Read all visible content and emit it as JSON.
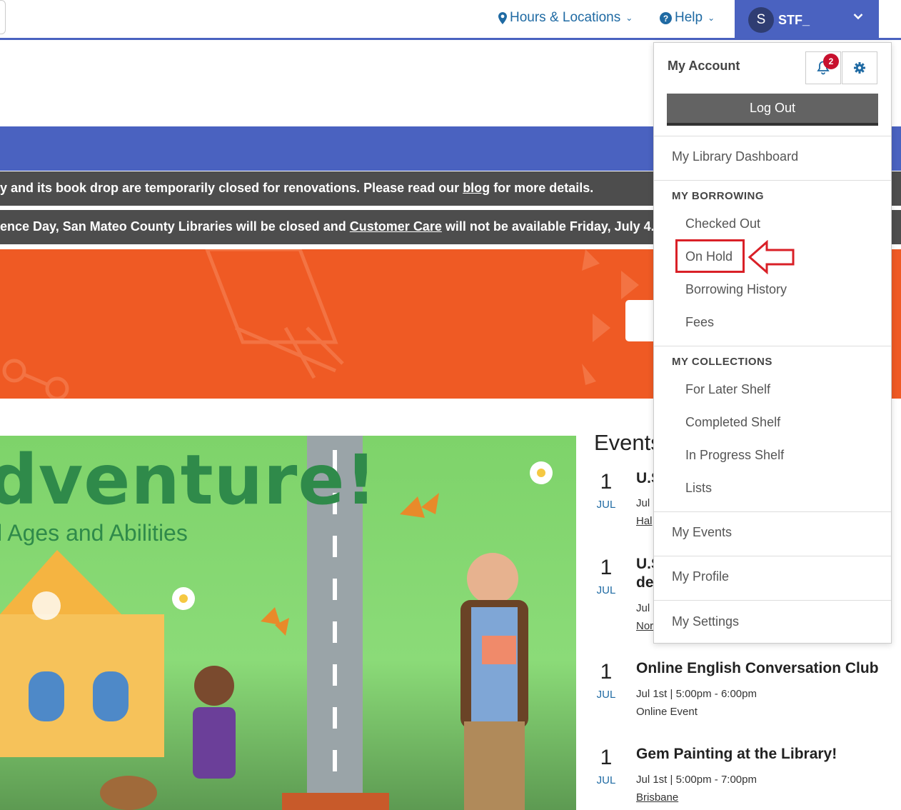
{
  "nav": {
    "hours_label": "Hours & Locations",
    "help_label": "Help",
    "account_initial": "S",
    "account_name": "STF_"
  },
  "alerts": {
    "alert1_pre": "y and its book drop are temporarily closed for renovations. Please read our ",
    "alert1_link": "blog",
    "alert1_post": " for more details.",
    "alert2_pre": "ence Day, San Mateo County Libraries will be closed and ",
    "alert2_link": "Customer Care",
    "alert2_post": " will not be available Friday, July 4."
  },
  "hero": {
    "title": "dventure!",
    "subtitle": "l Ages and Abilities"
  },
  "events": {
    "heading": "Events",
    "items": [
      {
        "day": "1",
        "month": "JUL",
        "title": "U.S",
        "title2": "",
        "time": "Jul 1",
        "location": "Hal"
      },
      {
        "day": "1",
        "month": "JUL",
        "title": "U.S",
        "title2": "de",
        "time": "Jul 1",
        "location": "Nor"
      },
      {
        "day": "1",
        "month": "JUL",
        "title": "Online English Conversation Club",
        "title2": "",
        "time": "Jul 1st | 5:00pm - 6:00pm",
        "location": "Online Event"
      },
      {
        "day": "1",
        "month": "JUL",
        "title": "Gem Painting at the Library!",
        "title2": "",
        "time": "Jul 1st | 5:00pm - 7:00pm",
        "location": "Brisbane"
      }
    ]
  },
  "dropdown": {
    "header": "My Account",
    "notification_count": "2",
    "logout_label": "Log Out",
    "dashboard": "My Library Dashboard",
    "borrowing_heading": "MY BORROWING",
    "borrowing_items": [
      "Checked Out",
      "On Hold",
      "Borrowing History",
      "Fees"
    ],
    "collections_heading": "MY COLLECTIONS",
    "collections_items": [
      "For Later Shelf",
      "Completed Shelf",
      "In Progress Shelf",
      "Lists"
    ],
    "events": "My Events",
    "profile": "My Profile",
    "settings": "My Settings"
  },
  "icons": {
    "location": "map-pin-icon",
    "help": "question-circle-icon",
    "notifications": "bell-icon",
    "settings": "gear-icon",
    "annotation": "arrow-left-icon"
  },
  "colors": {
    "brand_blue": "#4a62c0",
    "link_blue": "#1f6aa3",
    "alert_gray": "#4d4d4d",
    "orange": "#ef5a24",
    "highlight_red": "#d92027"
  }
}
